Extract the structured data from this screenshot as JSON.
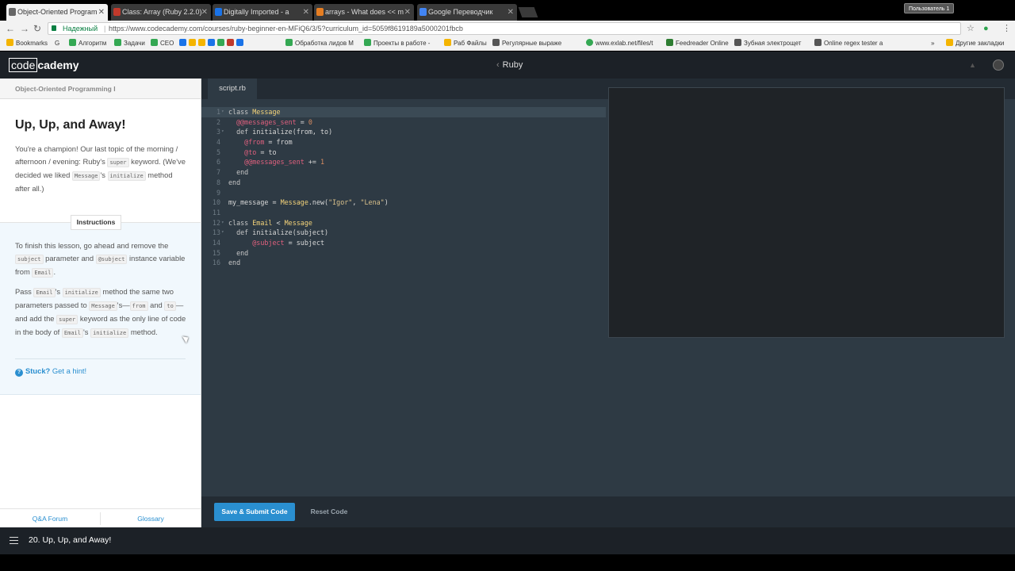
{
  "browser": {
    "tabs": [
      {
        "title": "Object-Oriented Program",
        "active": true,
        "color": "#666666"
      },
      {
        "title": "Class: Array (Ruby 2.2.0)",
        "active": false,
        "color": "#c0392b"
      },
      {
        "title": "Digitally Imported - a",
        "active": false,
        "color": "#1a73e8"
      },
      {
        "title": "arrays - What does << m",
        "active": false,
        "color": "#e67e22"
      },
      {
        "title": "Google Переводчик",
        "active": false,
        "color": "#4285f4"
      }
    ],
    "user_button": "Пользователь 1",
    "address": {
      "secure_label": "Надежный",
      "url": "https://www.codecademy.com/courses/ruby-beginner-en-MFiQ6/3/5?curriculum_id=5059f8619189a5000201fbcb"
    },
    "bookmarks": [
      {
        "label": "Bookmarks",
        "color": "#f4b400"
      },
      {
        "label": "G",
        "color": "#ffffff"
      },
      {
        "label": "Алгоритм",
        "color": "#34a853"
      },
      {
        "label": "Задачи",
        "color": "#34a853"
      },
      {
        "label": "CEO",
        "color": "#34a853"
      },
      {
        "label": "Обработка лидов М",
        "color": "#34a853"
      },
      {
        "label": "Проекты в работе -",
        "color": "#34a853"
      },
      {
        "label": "Раб Файлы",
        "color": "#f4b400"
      },
      {
        "label": "Регулярные выраже",
        "color": "#333333"
      },
      {
        "label": "www.exlab.net/files/t",
        "color": "#34a853"
      },
      {
        "label": "Feedreader Online",
        "color": "#2e7d32"
      },
      {
        "label": "Зубная электрощет",
        "color": "#555555"
      },
      {
        "label": "Online regex tester a",
        "color": "#555555"
      }
    ],
    "other_bookmarks": "Другие закладки"
  },
  "header": {
    "logo_boxed": "code",
    "logo_rest": "cademy",
    "breadcrumb": "Ruby"
  },
  "lesson": {
    "course_title": "Object-Oriented Programming I",
    "heading": "Up, Up, and Away!",
    "intro": {
      "t1": "You're a champion! Our last topic of the morning / afternoon / evening: Ruby's ",
      "c1": "super",
      "t2": " keyword. (We've decided we liked ",
      "c2": "Message",
      "t3": "'s ",
      "c3": "initialize",
      "t4": " method after all.)"
    },
    "instructions_label": "Instructions",
    "p1": {
      "t1": "To finish this lesson, go ahead and remove the ",
      "c1": "subject",
      "t2": " parameter and ",
      "c2": "@subject",
      "t3": " instance variable from ",
      "c3": "Email",
      "t4": "."
    },
    "p2": {
      "t1": "Pass ",
      "c1": "Email",
      "t2": "'s ",
      "c2": "initialize",
      "t3": " method the same two parameters passed to ",
      "c3": "Message",
      "t4": "'s—",
      "c4": "from",
      "t5": " and ",
      "c5": "to",
      "t6": "—and add the ",
      "c6": "super",
      "t7": " keyword as the only line of code in the body of ",
      "c7": "Email",
      "t8": "'s ",
      "c8": "initialize",
      "t9": " method."
    },
    "hint_bold": "Stuck?",
    "hint_link": "Get a hint!",
    "footer_left": "Q&A Forum",
    "footer_right": "Glossary"
  },
  "editor": {
    "file_tab": "script.rb",
    "lines": [
      {
        "n": "1",
        "fold": true,
        "code": "class Message"
      },
      {
        "n": "2",
        "fold": false,
        "code": "  @@messages_sent = 0"
      },
      {
        "n": "3",
        "fold": true,
        "code": "  def initialize(from, to)"
      },
      {
        "n": "4",
        "fold": false,
        "code": "    @from = from"
      },
      {
        "n": "5",
        "fold": false,
        "code": "    @to = to"
      },
      {
        "n": "6",
        "fold": false,
        "code": "    @@messages_sent += 1"
      },
      {
        "n": "7",
        "fold": false,
        "code": "  end"
      },
      {
        "n": "8",
        "fold": false,
        "code": "end"
      },
      {
        "n": "9",
        "fold": false,
        "code": ""
      },
      {
        "n": "10",
        "fold": false,
        "code": "my_message = Message.new(\"Igor\", \"Lena\")"
      },
      {
        "n": "11",
        "fold": false,
        "code": ""
      },
      {
        "n": "12",
        "fold": true,
        "code": "class Email < Message"
      },
      {
        "n": "13",
        "fold": true,
        "code": "  def initialize(subject)"
      },
      {
        "n": "14",
        "fold": false,
        "code": "      @subject = subject"
      },
      {
        "n": "15",
        "fold": false,
        "code": "  end"
      },
      {
        "n": "16",
        "fold": false,
        "code": "end"
      }
    ],
    "submit_label": "Save & Submit Code",
    "reset_label": "Reset Code"
  },
  "bottom": {
    "lesson_title": "20. Up, Up, and Away!"
  },
  "colors": {
    "accent": "#2a8fd0",
    "header_bg": "#1c2127",
    "editor_bg": "#2e3a44"
  }
}
